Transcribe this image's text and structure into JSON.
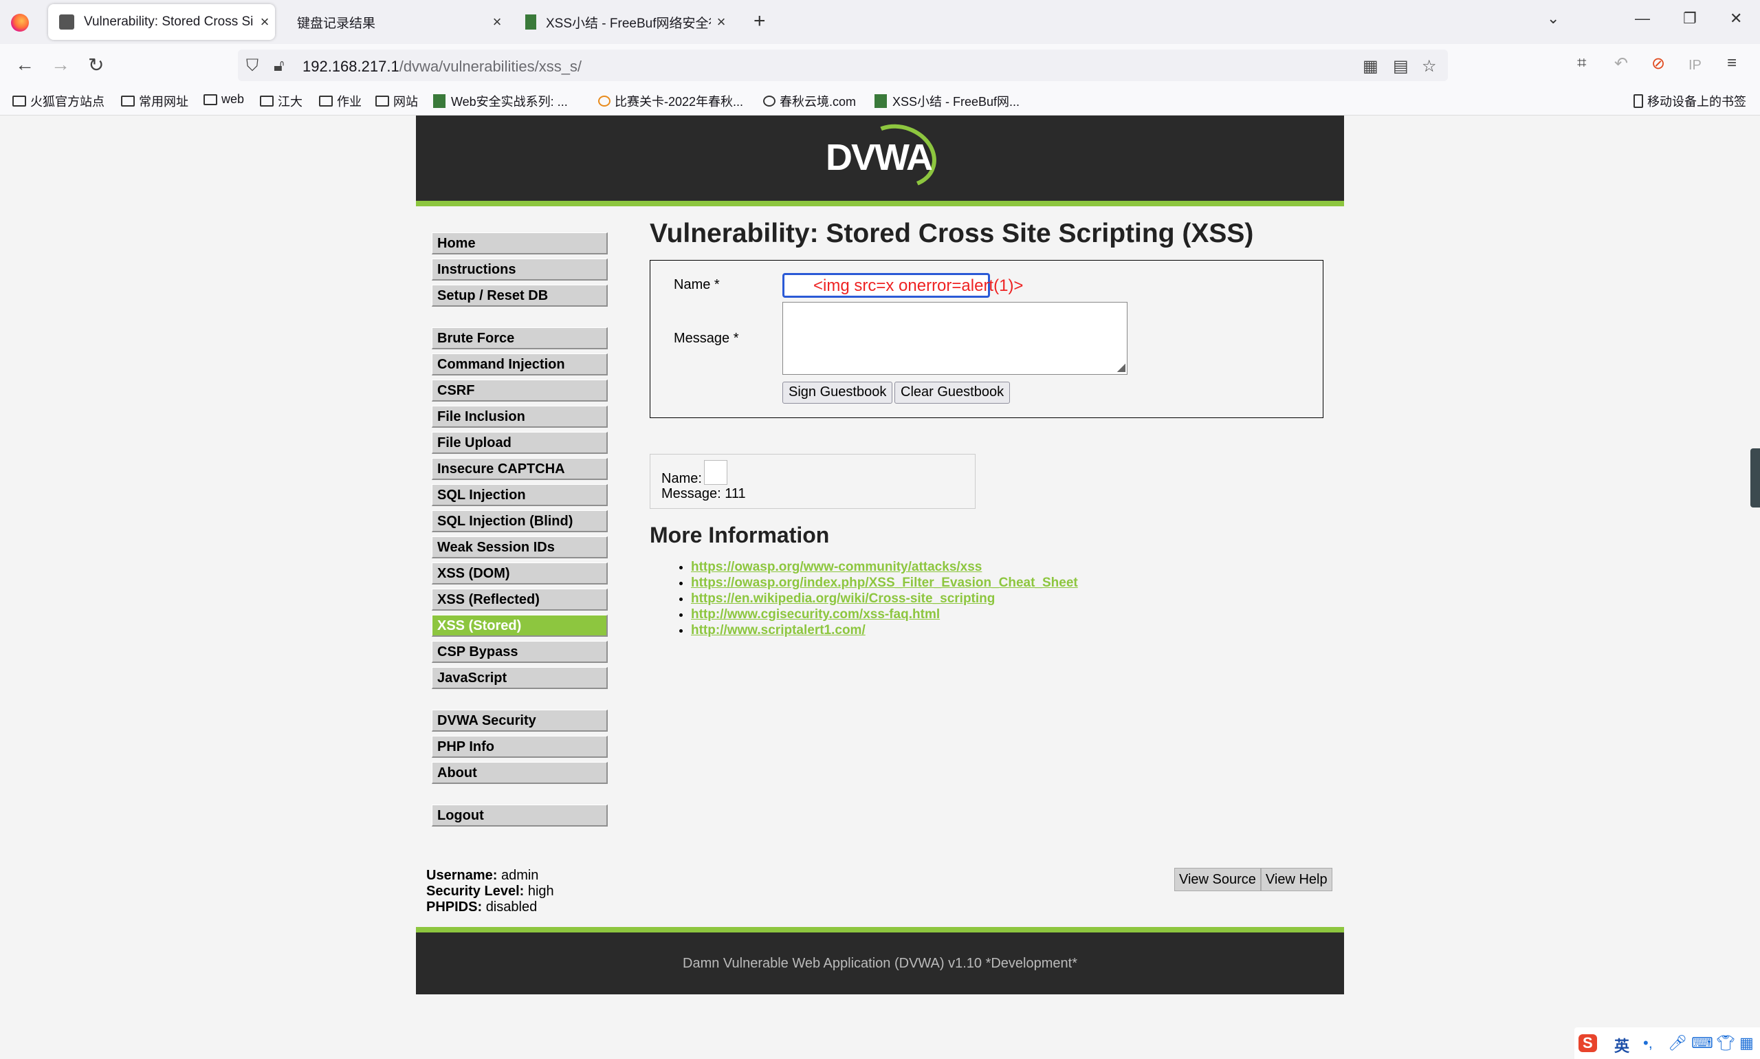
{
  "browser": {
    "tabs": [
      {
        "label": "Vulnerability: Stored Cross Si",
        "active": true
      },
      {
        "label": "键盘记录结果",
        "active": false
      },
      {
        "label": "XSS小结 - FreeBuf网络安全行业",
        "active": false
      }
    ],
    "url_host": "192.168.217.1",
    "url_path": "/dvwa/vulnerabilities/xss_s/",
    "bookmarks": [
      "火狐官方站点",
      "常用网址",
      "web",
      "江大",
      "作业",
      "网站",
      "Web安全实战系列: ...",
      "比赛关卡-2022年春秋...",
      "春秋云境.com",
      "XSS小结 - FreeBuf网..."
    ],
    "mobile_bookmarks": "移动设备上的书签"
  },
  "header": {
    "logo": "DVWA"
  },
  "menu": {
    "group1": [
      "Home",
      "Instructions",
      "Setup / Reset DB"
    ],
    "group2": [
      "Brute Force",
      "Command Injection",
      "CSRF",
      "File Inclusion",
      "File Upload",
      "Insecure CAPTCHA",
      "SQL Injection",
      "SQL Injection (Blind)",
      "Weak Session IDs",
      "XSS (DOM)",
      "XSS (Reflected)",
      "XSS (Stored)",
      "CSP Bypass",
      "JavaScript"
    ],
    "group3": [
      "DVWA Security",
      "PHP Info",
      "About"
    ],
    "group4": [
      "Logout"
    ],
    "selected": "XSS (Stored)"
  },
  "main": {
    "title": "Vulnerability: Stored Cross Site Scripting (XSS)",
    "name_label": "Name *",
    "name_value": "<img src=x onerror=alert(1)>",
    "message_label": "Message *",
    "message_value": "",
    "sign_button": "Sign Guestbook",
    "clear_button": "Clear Guestbook",
    "entry_name_label": "Name:",
    "entry_message": "Message: 111",
    "more_info_title": "More Information",
    "links": [
      "https://owasp.org/www-community/attacks/xss",
      "https://owasp.org/index.php/XSS_Filter_Evasion_Cheat_Sheet",
      "https://en.wikipedia.org/wiki/Cross-site_scripting",
      "http://www.cgisecurity.com/xss-faq.html",
      "http://www.scriptalert1.com/"
    ]
  },
  "status": {
    "username_label": "Username:",
    "username": "admin",
    "security_label": "Security Level:",
    "security": "high",
    "phpids_label": "PHPIDS:",
    "phpids": "disabled"
  },
  "view_source": "View Source",
  "view_help": "View Help",
  "footer": "Damn Vulnerable Web Application (DVWA) v1.10 *Development*",
  "taskbar": {
    "ime": "英"
  },
  "colors": {
    "accent": "#8dc63f",
    "header": "#2a2a2a",
    "focus": "#2b5ad6",
    "inputText": "#e22222"
  }
}
